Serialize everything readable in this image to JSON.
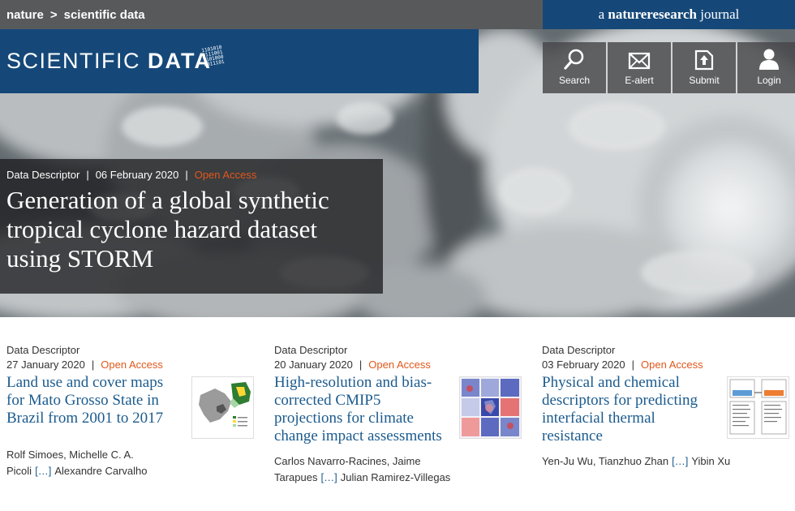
{
  "breadcrumb": {
    "parent": "nature",
    "separator": ">",
    "current": "scientific data"
  },
  "brand_journal": {
    "prefix": "a",
    "brand": "natureresearch",
    "suffix": "journal"
  },
  "logo": {
    "light": "SCIENTIFIC ",
    "bold": "DATA"
  },
  "toolbar": [
    {
      "label": "Search",
      "icon": "search-icon"
    },
    {
      "label": "E-alert",
      "icon": "envelope-icon"
    },
    {
      "label": "Submit",
      "icon": "upload-icon"
    },
    {
      "label": "Login",
      "icon": "user-icon"
    }
  ],
  "featured": {
    "type": "Data Descriptor",
    "date": "06 February 2020",
    "access": "Open Access",
    "title": "Generation of a global synthetic tropical cyclone hazard dataset using STORM"
  },
  "articles": [
    {
      "type": "Data Descriptor",
      "date": "27 January 2020",
      "access": "Open Access",
      "title": "Land use and cover maps for Mato Grosso State in Brazil from 2001 to 2017",
      "authors_before": "Rolf Simoes, Michelle C. A. Picoli",
      "more": "[…]",
      "authors_after": "Alexandre Carvalho"
    },
    {
      "type": "Data Descriptor",
      "date": "20 January 2020",
      "access": "Open Access",
      "title": "High-resolution and bias-corrected CMIP5 projections for climate change impact assessments",
      "authors_before": "Carlos Navarro-Racines, Jaime Tarapues",
      "more": "[…]",
      "authors_after": "Julian Ramirez-Villegas"
    },
    {
      "type": "Data Descriptor",
      "date": "03 February 2020",
      "access": "Open Access",
      "title": "Physical and chemical descriptors for predicting interfacial thermal resistance",
      "authors_before": "Yen-Ju Wu, Tianzhuo Zhan",
      "more": "[…]",
      "authors_after": "Yibin Xu"
    }
  ],
  "colors": {
    "brand_blue": "#154879",
    "topbar_gray": "#58595b",
    "open_access": "#e0581b",
    "link_blue": "#1b5b8e"
  }
}
